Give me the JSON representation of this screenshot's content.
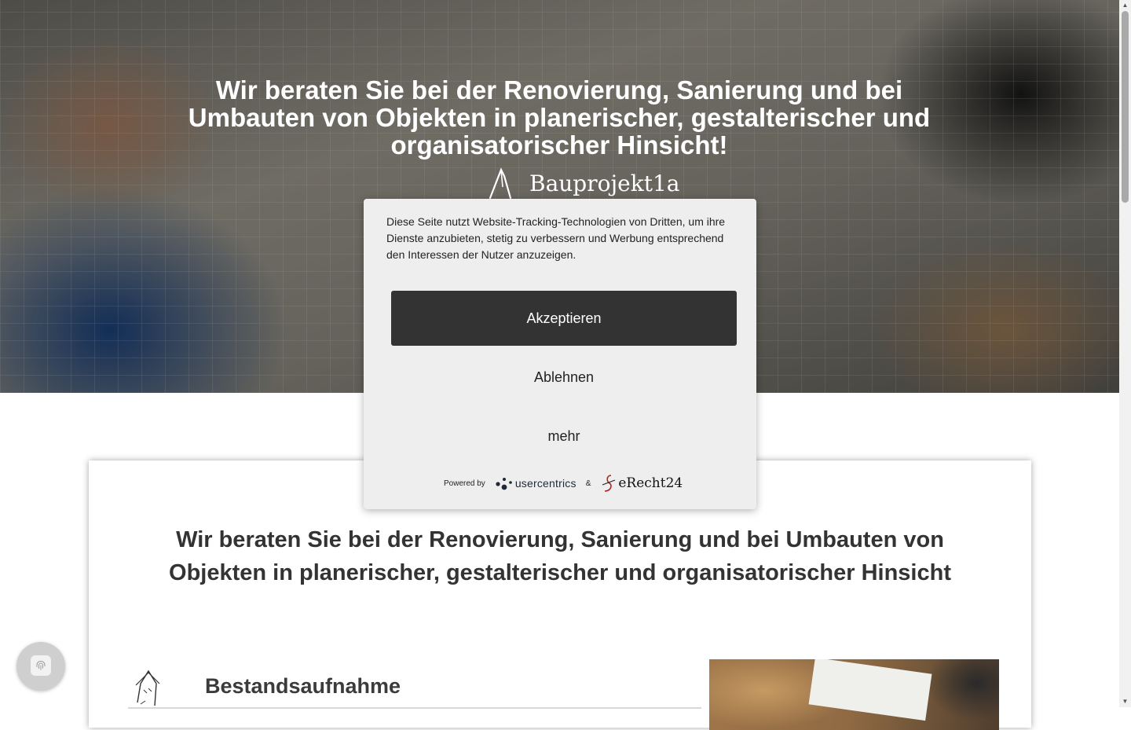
{
  "hero": {
    "title": "Wir beraten Sie bei der Renovierung, Sanierung und bei Umbauten von Objekten in planerischer, gestalterischer und organisatorischer Hinsicht!",
    "logo_text": "Bauprojekt1a"
  },
  "main": {
    "title": "Wir beraten Sie bei der Renovierung, Sanierung und bei Umbauten von Objekten in planerischer, gestalterischer und organisatorischer Hinsicht",
    "service": {
      "title": "Bestandsaufnahme",
      "icon": "house-sketch-icon"
    }
  },
  "cookie_dialog": {
    "text": "Diese Seite nutzt Website-Tracking-Technologien von Dritten, um ihre Dienste anzubieten, stetig zu verbessern und Werbung entsprechend den Interessen der Nutzer anzuzeigen.",
    "accept_label": "Akzeptieren",
    "decline_label": "Ablehnen",
    "more_label": "mehr",
    "powered_by_label": "Powered by",
    "provider_one": "usercentrics",
    "ampersand": "&",
    "provider_two": "eRecht24"
  },
  "privacy_button": {
    "icon": "fingerprint-icon"
  },
  "colors": {
    "accept_button": "#333333",
    "dialog_background": "#eeeeee",
    "heading_text": "#333333"
  }
}
